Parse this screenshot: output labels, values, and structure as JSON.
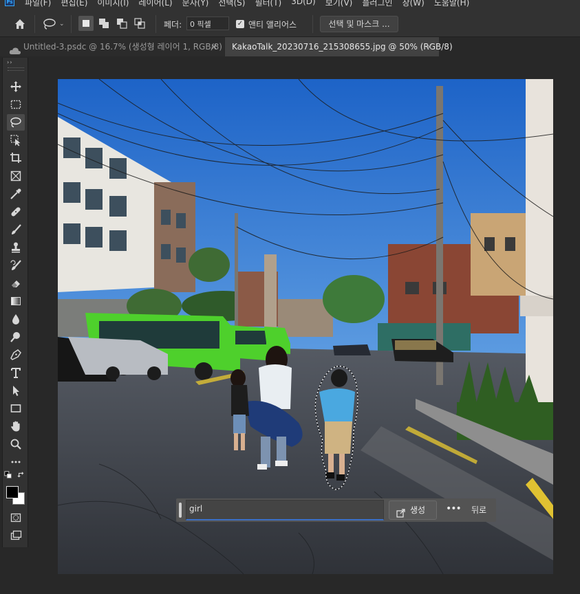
{
  "app": {
    "logo": "Ps"
  },
  "menu": [
    "파일(F)",
    "편집(E)",
    "이미지(I)",
    "레이어(L)",
    "문자(Y)",
    "선택(S)",
    "필터(T)",
    "3D(D)",
    "보기(V)",
    "플러그인",
    "창(W)",
    "도움말(H)"
  ],
  "options": {
    "feather_label": "페더:",
    "feather_value": "0 픽셀",
    "anti_alias_label": "앤티 앨리어스",
    "anti_alias_checked": true,
    "select_mask_label": "선택 및 마스크 ..."
  },
  "tabs": [
    {
      "label": "Untitled-3.psdc @ 16.7% (생성형 레이어 1, RGB/8)",
      "close": "×",
      "active": false,
      "icon": "cloud-icon"
    },
    {
      "label": "KakaoTalk_20230716_215308655.jpg @ 50% (RGB/8)",
      "close": "×",
      "active": true
    }
  ],
  "toolbar": {
    "collapse": "››",
    "tools": [
      "move-tool",
      "marquee-tool",
      "lasso-tool",
      "object-selection-tool",
      "crop-tool",
      "frame-tool",
      "eyedropper-tool",
      "healing-brush-tool",
      "brush-tool",
      "clone-stamp-tool",
      "history-brush-tool",
      "eraser-tool",
      "gradient-tool",
      "blur-tool",
      "dodge-tool",
      "pen-tool",
      "type-tool",
      "path-selection-tool",
      "rectangle-tool",
      "hand-tool",
      "zoom-tool",
      "more-tools"
    ],
    "active_tool": "lasso-tool",
    "foreground_color": "#000000",
    "background_color": "#ffffff"
  },
  "generative_bar": {
    "prompt_value": "girl",
    "generate_label": "생성",
    "more_label": "•••",
    "back_label": "뒤로"
  },
  "colors": {
    "accent": "#3b6fc6",
    "panel": "#323232",
    "workspace": "#282828"
  }
}
